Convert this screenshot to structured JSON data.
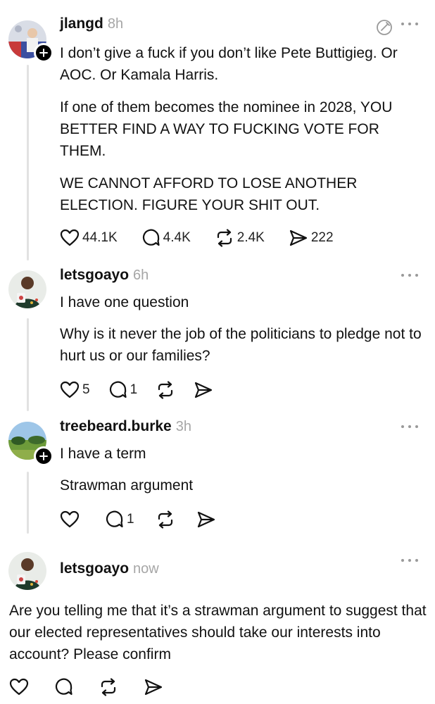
{
  "posts": [
    {
      "username": "jlangd",
      "time": "8h",
      "paragraphs": [
        "I don’t give a fuck if you don’t like Pete Buttigieg. Or AOC. Or Kamala Harris.",
        "If one of them becomes the nominee in 2028, YOU BETTER FIND A WAY TO FUCKING VOTE FOR THEM.",
        "WE CANNOT AFFORD TO LOSE ANOTHER ELECTION. FIGURE YOUR SHIT OUT."
      ],
      "counts": {
        "likes": "44.1K",
        "replies": "4.4K",
        "reposts": "2.4K",
        "shares": "222"
      }
    },
    {
      "username": "letsgoayo",
      "time": "6h",
      "paragraphs": [
        "I have one question",
        "Why is it never the job of the politicians to pledge not to hurt us or our families?"
      ],
      "counts": {
        "likes": "5",
        "replies": "1"
      }
    },
    {
      "username": "treebeard.burke",
      "time": "3h",
      "paragraphs": [
        "I have a term",
        "Strawman argument"
      ],
      "counts": {
        "replies": "1"
      }
    },
    {
      "username": "letsgoayo",
      "time": "now",
      "paragraphs": [
        "Are you telling me that it’s a strawman argument to suggest that our elected representatives should take our interests into account? Please confirm"
      ]
    }
  ],
  "icons": {
    "like": "heart-icon",
    "reply": "comment-icon",
    "repost": "repost-icon",
    "share": "send-icon",
    "more": "more-options-icon",
    "follow": "plus-icon",
    "edit": "edit-circle-icon"
  }
}
